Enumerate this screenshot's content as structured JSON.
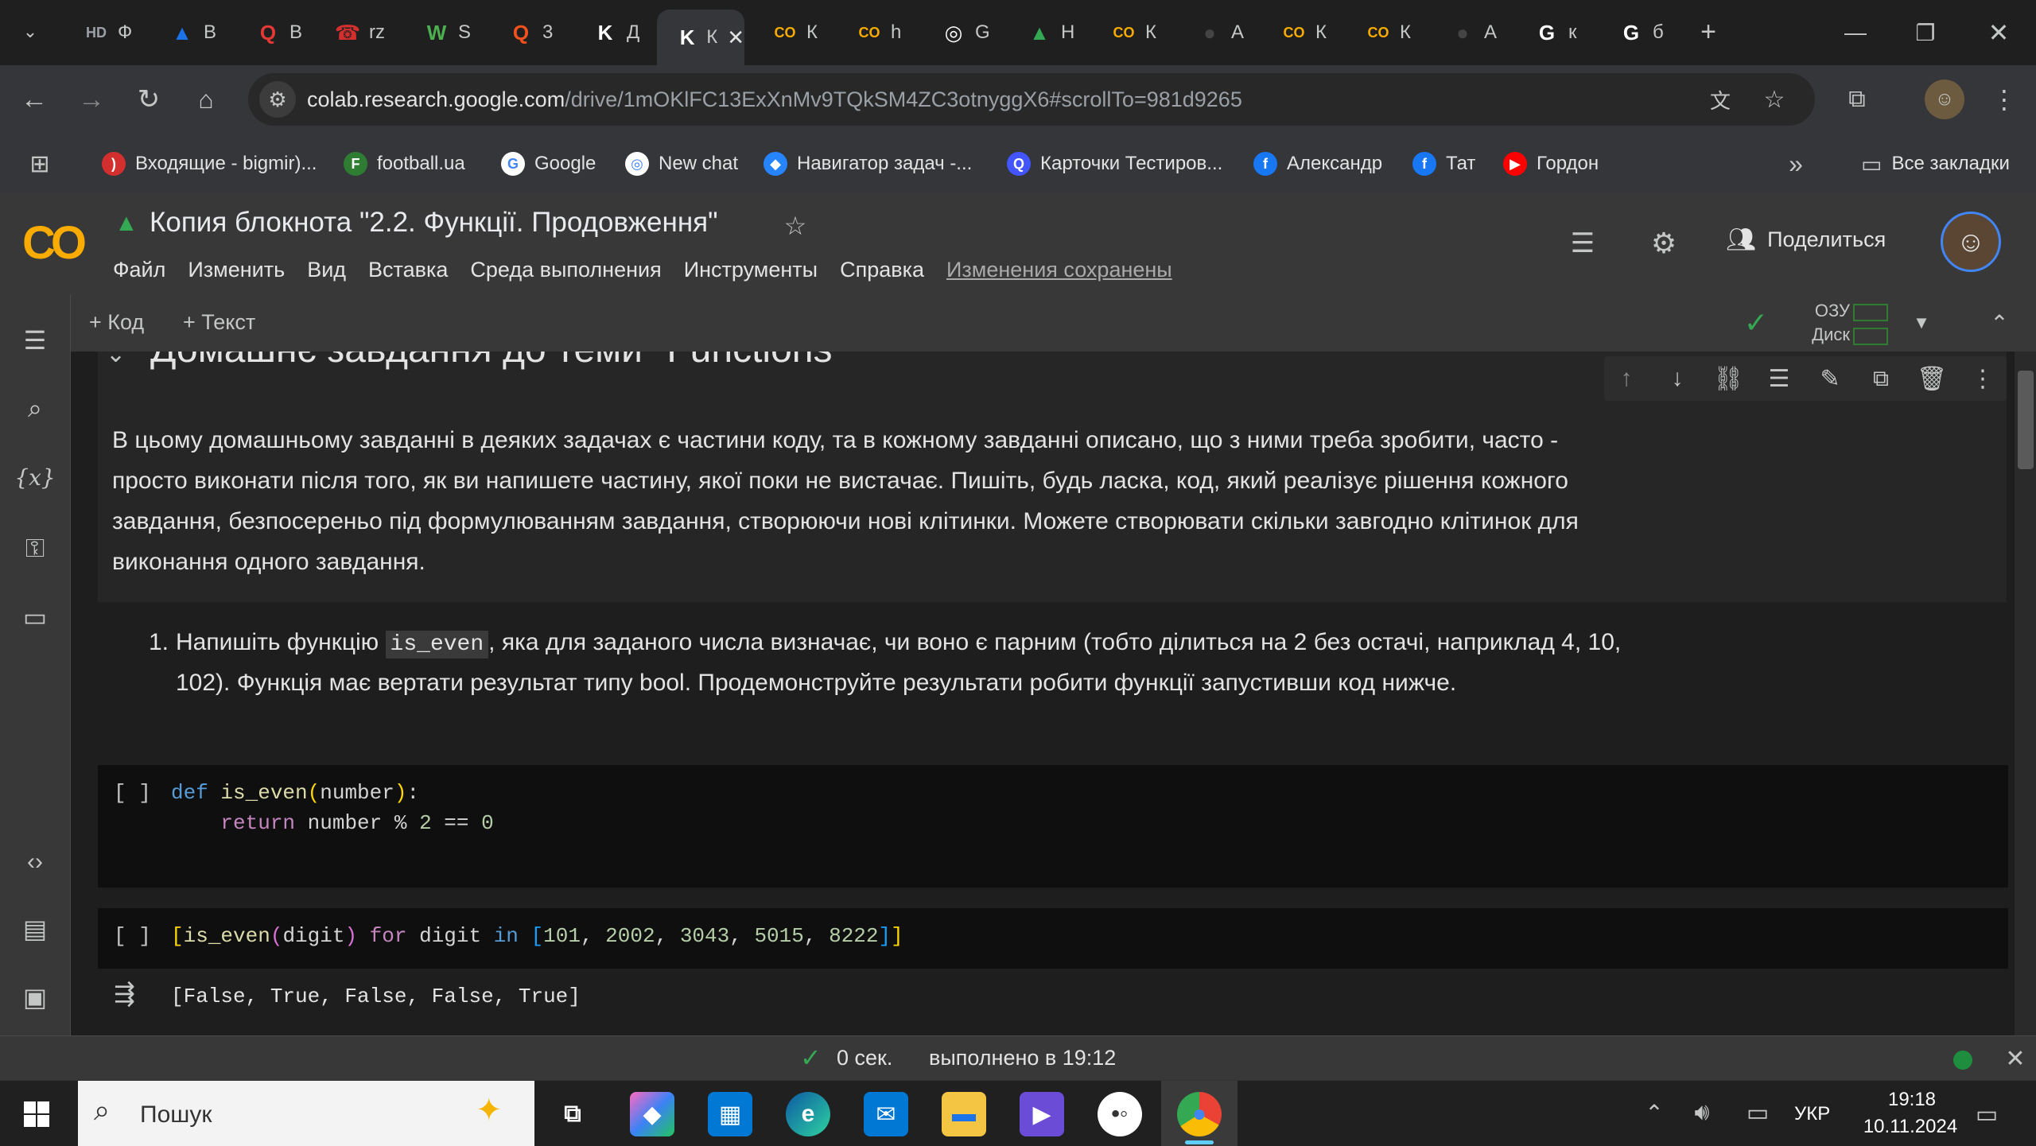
{
  "tabs": [
    {
      "label": "Ф",
      "icon": "hd-icon",
      "color": "#9aa0a6",
      "glyph": "HD"
    },
    {
      "label": "В",
      "icon": "azure-icon",
      "color": "#1a73e8",
      "glyph": "▲"
    },
    {
      "label": "В",
      "icon": "q-red-icon",
      "color": "#e53935",
      "glyph": "Q"
    },
    {
      "label": "rz",
      "icon": "rz-icon",
      "color": "#d32f2f",
      "glyph": "☎"
    },
    {
      "label": "S",
      "icon": "w3-icon",
      "color": "#4caf50",
      "glyph": "W"
    },
    {
      "label": "3",
      "icon": "quiz-icon",
      "color": "#f4511e",
      "glyph": "Q"
    },
    {
      "label": "Д",
      "icon": "k-icon",
      "color": "#ffffff",
      "glyph": "K"
    },
    {
      "label": "К",
      "icon": "k-tab-icon",
      "color": "#ffffff",
      "glyph": "K"
    },
    {
      "label": "К",
      "icon": "colab-icon",
      "color": "#f9ab00",
      "glyph": "CO"
    },
    {
      "label": "h",
      "icon": "colab-icon",
      "color": "#f9ab00",
      "glyph": "CO"
    },
    {
      "label": "G",
      "icon": "chatgpt-icon",
      "color": "#ffffff",
      "glyph": "◎"
    },
    {
      "label": "Н",
      "icon": "drive-icon",
      "color": "#34a853",
      "glyph": "▲"
    },
    {
      "label": "К",
      "icon": "colab-icon",
      "color": "#f9ab00",
      "glyph": "CO"
    },
    {
      "label": "А",
      "icon": "github-icon",
      "color": "#444",
      "glyph": "●"
    },
    {
      "label": "К",
      "icon": "colab-icon",
      "color": "#f9ab00",
      "glyph": "CO"
    },
    {
      "label": "К",
      "icon": "colab-icon",
      "color": "#f9ab00",
      "glyph": "CO"
    },
    {
      "label": "А",
      "icon": "github-icon",
      "color": "#444",
      "glyph": "●"
    },
    {
      "label": "к",
      "icon": "google-icon",
      "color": "#ffffff",
      "glyph": "G"
    },
    {
      "label": "б",
      "icon": "google-icon",
      "color": "#ffffff",
      "glyph": "G"
    }
  ],
  "address": {
    "host": "colab.research.google.com",
    "path": "/drive/1mOKlFC13ExXnMv9TQkSM4ZC3otnyggX6#scrollTo=981d9265"
  },
  "bookmarks": [
    {
      "label": "Входящие - bigmir)...",
      "icon": "bigmir-icon",
      "color": "#d32f2f",
      "glyph": ")"
    },
    {
      "label": "football.ua",
      "icon": "football-icon",
      "color": "#2e7d32",
      "glyph": "F"
    },
    {
      "label": "Google",
      "icon": "google-icon",
      "color": "#ffffff",
      "glyph": "G"
    },
    {
      "label": "New chat",
      "icon": "chatgpt-icon",
      "color": "#ffffff",
      "glyph": "◎"
    },
    {
      "label": "Навигатор задач -...",
      "icon": "jira-icon",
      "color": "#2684ff",
      "glyph": "◆"
    },
    {
      "label": "Карточки Тестиров...",
      "icon": "quizlet-icon",
      "color": "#4255ff",
      "glyph": "Q"
    },
    {
      "label": "Александр",
      "icon": "facebook-icon",
      "color": "#1877f2",
      "glyph": "f"
    },
    {
      "label": "Тат",
      "icon": "facebook-icon",
      "color": "#1877f2",
      "glyph": "f"
    },
    {
      "label": "Гордон",
      "icon": "youtube-icon",
      "color": "#ff0000",
      "glyph": "▶"
    }
  ],
  "bookmarks_all": "Все закладки",
  "colab": {
    "logo": "CO",
    "title": "Копия блокнота \"2.2. Функції. Продовження\"",
    "menu": [
      "Файл",
      "Изменить",
      "Вид",
      "Вставка",
      "Среда выполнения",
      "Инструменты",
      "Справка"
    ],
    "saved": "Изменения сохранены",
    "share": "Поделиться",
    "add_code": "+ Код",
    "add_text": "+ Текст",
    "ram": "ОЗУ",
    "disk": "Диск"
  },
  "notebook": {
    "heading": "Домашнє завдання до теми \"Functions\"",
    "intro": [
      "В цьому домашньому завданні в деяких задачах є частини коду, та в кожному завданні описано, що з ними треба зробити, часто -",
      "просто виконати після того, як ви напишете частину, якої поки не вистачає. Пишіть, будь ласка, код, який реалізує рішення кожного",
      "завдання, безпосереньо під формулюванням завдання, створюючи нові клітинки. Можете створювати скільки завгодно клітинок для",
      "виконання одного завдання."
    ],
    "task1_num": "1.",
    "task1_before": "Напишіть функцію",
    "task1_code": "is_even",
    "task1_after": ", яка для заданого числа визначає, чи воно є парним (тобто ділиться на 2 без остачі, наприклад 4, 10,",
    "task1_line2": "102). Функція має вертати результат типу bool. Продемонструйте результати робити функції запустивши код нижче.",
    "cell1_prompt": "[ ]",
    "cell2_prompt": "[ ]",
    "cell2_output": "[False, True, False, False, True]"
  },
  "status": {
    "time": "0 сек.",
    "done": "выполнено в 19:12"
  },
  "taskbar": {
    "search": "Пошук",
    "lang": "УКР",
    "time": "19:18",
    "date": "10.11.2024"
  }
}
